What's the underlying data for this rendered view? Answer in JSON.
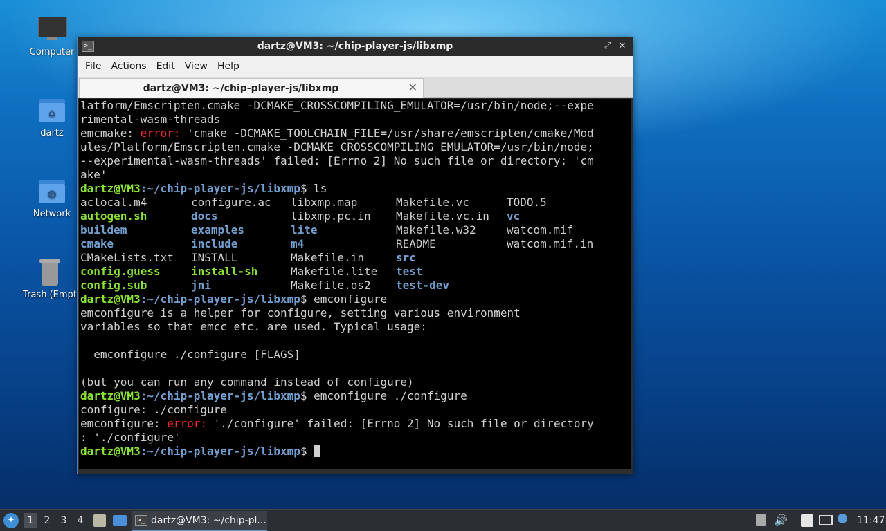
{
  "desktop": {
    "icons": [
      {
        "label": "Computer"
      },
      {
        "label": "dartz"
      },
      {
        "label": "Network"
      },
      {
        "label": "Trash (Empt"
      }
    ]
  },
  "window": {
    "title": "dartz@VM3: ~/chip-player-js/libxmp",
    "controls": {
      "minimize": "–",
      "maximize": "⤢",
      "close": "✕"
    },
    "menu": [
      "File",
      "Actions",
      "Edit",
      "View",
      "Help"
    ],
    "tab": {
      "label": "dartz@VM3: ~/chip-player-js/libxmp",
      "close": "✕"
    }
  },
  "terminal": {
    "prompt_user": "dartz@VM3",
    "prompt_path": ":~/chip-player-js/libxmp",
    "prompt_symbol": "$ ",
    "l1": "latform/Emscripten.cmake -DCMAKE_CROSSCOMPILING_EMULATOR=/usr/bin/node;--expe",
    "l2": "rimental-wasm-threads",
    "l3a": "emcmake: ",
    "l3b": "error:",
    "l3c": " 'cmake -DCMAKE_TOOLCHAIN_FILE=/usr/share/emscripten/cmake/Mod",
    "l4": "ules/Platform/Emscripten.cmake -DCMAKE_CROSSCOMPILING_EMULATOR=/usr/bin/node;",
    "l5": "--experimental-wasm-threads' failed: [Errno 2] No such file or directory: 'cm",
    "l6": "ake'",
    "cmd_ls": "ls",
    "ls": [
      [
        "aclocal.m4",
        "configure.ac",
        "libxmp.map",
        "Makefile.vc",
        "TODO.5"
      ],
      [
        "autogen.sh",
        "docs",
        "libxmp.pc.in",
        "Makefile.vc.in",
        "vc"
      ],
      [
        "buildem",
        "examples",
        "lite",
        "Makefile.w32",
        "watcom.mif"
      ],
      [
        "cmake",
        "include",
        "m4",
        "README",
        "watcom.mif.in"
      ],
      [
        "CMakeLists.txt",
        "INSTALL",
        "Makefile.in",
        "src",
        ""
      ],
      [
        "config.guess",
        "install-sh",
        "Makefile.lite",
        "test",
        ""
      ],
      [
        "config.sub",
        "jni",
        "Makefile.os2",
        "test-dev",
        ""
      ]
    ],
    "cmd_emconfigure": "emconfigure",
    "h1": "emconfigure is a helper for configure, setting various environment",
    "h2": "variables so that emcc etc. are used. Typical usage:",
    "h3": "",
    "h4": "  emconfigure ./configure [FLAGS]",
    "h5": "",
    "h6": "(but you can run any command instead of configure)",
    "cmd_emconfigure_configure": "emconfigure ./configure",
    "c1": "configure: ./configure",
    "c2a": "emconfigure: ",
    "c2b": "error:",
    "c2c": " './configure' failed: [Errno 2] No such file or directory",
    "c3": ": './configure'"
  },
  "taskbar": {
    "workspaces": [
      "1",
      "2",
      "3",
      "4"
    ],
    "task_label": "dartz@VM3: ~/chip-pl...",
    "clock": "11:47"
  }
}
